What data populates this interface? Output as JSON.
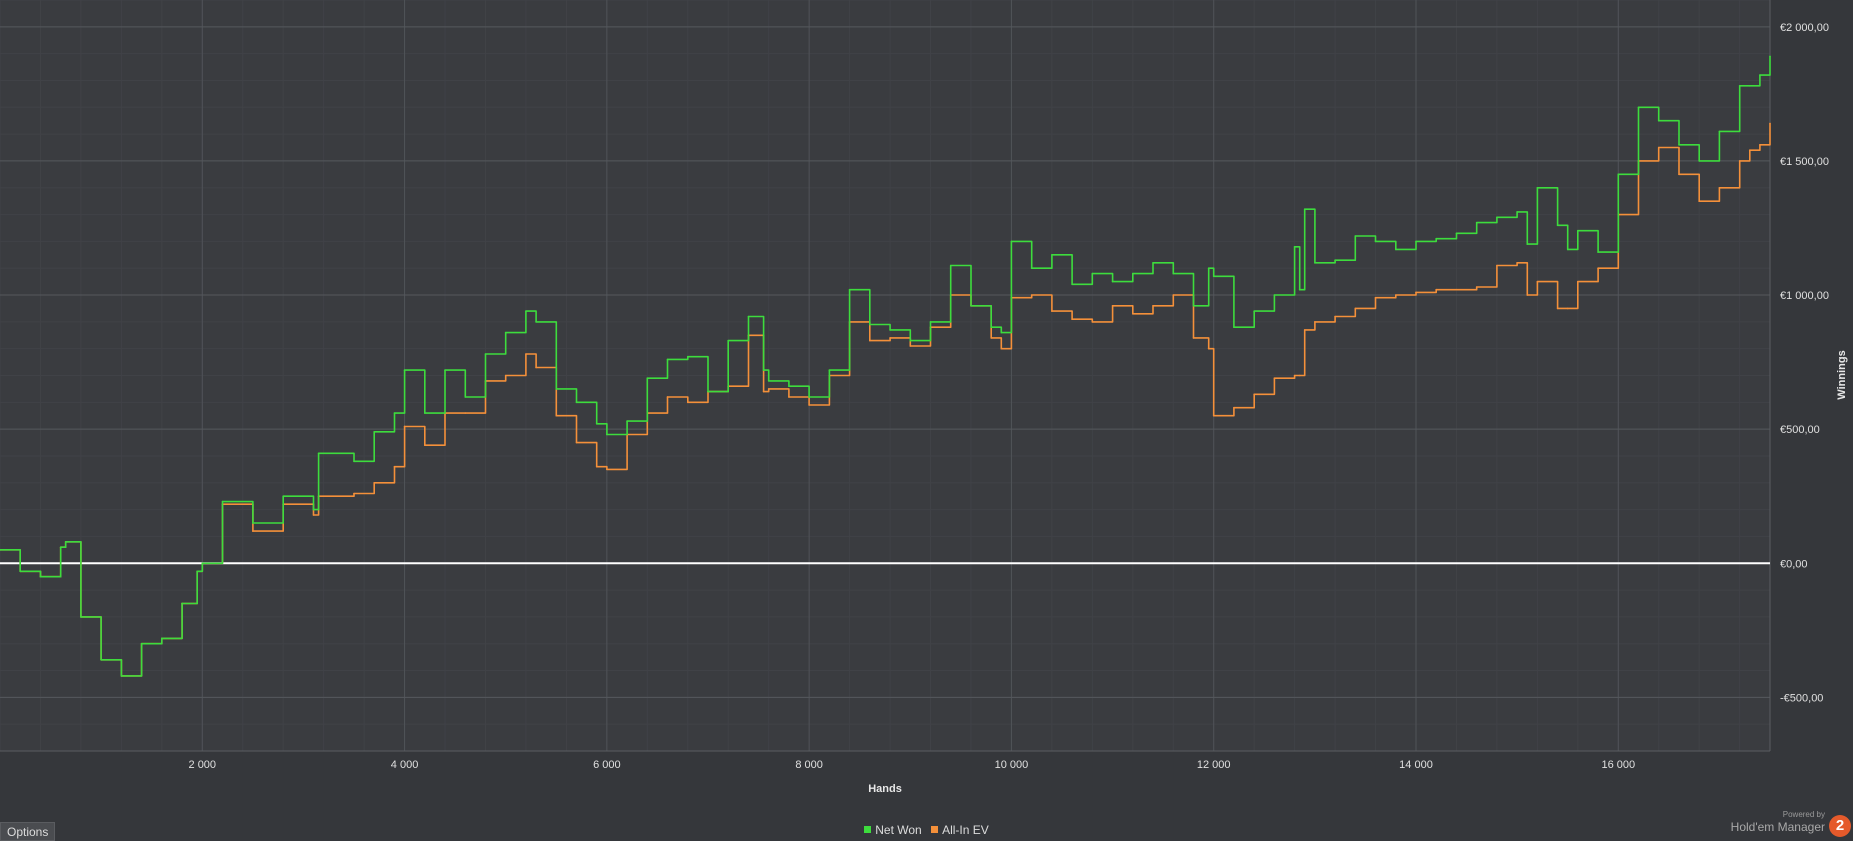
{
  "chart_data": {
    "type": "line",
    "title": "",
    "xlabel": "Hands",
    "ylabel": "Winnings",
    "xlim": [
      0,
      17500
    ],
    "ylim": [
      -700,
      2100
    ],
    "x_ticks": [
      2000,
      4000,
      6000,
      8000,
      10000,
      12000,
      14000,
      16000
    ],
    "x_tick_labels": [
      "2 000",
      "4 000",
      "6 000",
      "8 000",
      "10 000",
      "12 000",
      "14 000",
      "16 000"
    ],
    "y_ticks": [
      2000,
      1500,
      1000,
      500,
      0,
      -500
    ],
    "y_tick_labels": [
      "€2 000,00",
      "€1 500,00",
      "€1 000,00",
      "€500,00",
      "€0,00",
      "-€500,00"
    ],
    "grid": true,
    "legend_position": "bottom-center",
    "zero_line": true,
    "series": [
      {
        "name": "Net Won",
        "color": "#3ddc3d",
        "x": [
          0,
          200,
          400,
          600,
          650,
          800,
          1000,
          1200,
          1400,
          1600,
          1800,
          1950,
          2000,
          2200,
          2500,
          2800,
          3100,
          3150,
          3500,
          3700,
          3900,
          4000,
          4200,
          4400,
          4600,
          4800,
          5000,
          5200,
          5300,
          5500,
          5700,
          5900,
          6000,
          6200,
          6400,
          6600,
          6800,
          7000,
          7200,
          7400,
          7550,
          7600,
          7800,
          8000,
          8200,
          8400,
          8600,
          8800,
          9000,
          9200,
          9400,
          9600,
          9800,
          9900,
          10000,
          10200,
          10400,
          10600,
          10800,
          11000,
          11200,
          11400,
          11600,
          11800,
          11950,
          12000,
          12200,
          12400,
          12600,
          12800,
          12850,
          12900,
          13000,
          13200,
          13400,
          13600,
          13800,
          14000,
          14200,
          14400,
          14600,
          14800,
          15000,
          15100,
          15200,
          15400,
          15500,
          15600,
          15800,
          16000,
          16200,
          16400,
          16600,
          16800,
          17000,
          17200,
          17300,
          17400,
          17500
        ],
        "y": [
          50,
          -30,
          -50,
          60,
          80,
          -200,
          -360,
          -420,
          -300,
          -280,
          -150,
          -30,
          0,
          230,
          150,
          250,
          200,
          410,
          380,
          490,
          560,
          720,
          560,
          720,
          620,
          780,
          860,
          940,
          900,
          650,
          600,
          520,
          480,
          530,
          690,
          760,
          770,
          640,
          830,
          920,
          720,
          680,
          660,
          620,
          720,
          1020,
          890,
          870,
          830,
          900,
          1110,
          960,
          880,
          860,
          1200,
          1100,
          1150,
          1040,
          1080,
          1050,
          1080,
          1120,
          1080,
          960,
          1100,
          1070,
          880,
          940,
          1000,
          1180,
          1020,
          1320,
          1120,
          1130,
          1220,
          1200,
          1170,
          1200,
          1210,
          1230,
          1270,
          1290,
          1310,
          1190,
          1400,
          1260,
          1170,
          1240,
          1160,
          1450,
          1700,
          1650,
          1560,
          1500,
          1610,
          1780,
          1780,
          1820,
          1890
        ]
      },
      {
        "name": "All-In EV",
        "color": "#f4903a",
        "x": [
          0,
          200,
          400,
          600,
          650,
          800,
          1000,
          1200,
          1400,
          1600,
          1800,
          1950,
          2000,
          2200,
          2500,
          2800,
          3100,
          3150,
          3500,
          3700,
          3900,
          4000,
          4200,
          4400,
          4600,
          4800,
          5000,
          5200,
          5300,
          5500,
          5700,
          5900,
          6000,
          6200,
          6400,
          6600,
          6800,
          7000,
          7200,
          7400,
          7550,
          7600,
          7800,
          8000,
          8200,
          8400,
          8600,
          8800,
          9000,
          9200,
          9400,
          9600,
          9800,
          9900,
          10000,
          10200,
          10400,
          10600,
          10800,
          11000,
          11200,
          11400,
          11600,
          11800,
          11950,
          12000,
          12200,
          12400,
          12600,
          12800,
          12850,
          12900,
          13000,
          13200,
          13400,
          13600,
          13800,
          14000,
          14200,
          14400,
          14600,
          14800,
          15000,
          15100,
          15200,
          15400,
          15500,
          15600,
          15800,
          16000,
          16200,
          16400,
          16600,
          16800,
          17000,
          17200,
          17300,
          17400,
          17500
        ],
        "y": [
          50,
          -30,
          -50,
          60,
          80,
          -200,
          -360,
          -420,
          -300,
          -280,
          -150,
          -30,
          0,
          220,
          120,
          220,
          180,
          250,
          260,
          300,
          360,
          510,
          440,
          560,
          560,
          680,
          700,
          780,
          730,
          550,
          450,
          360,
          350,
          480,
          560,
          620,
          600,
          640,
          660,
          850,
          640,
          650,
          620,
          590,
          700,
          900,
          830,
          840,
          810,
          880,
          1000,
          960,
          840,
          800,
          990,
          1000,
          940,
          910,
          900,
          960,
          930,
          960,
          1000,
          840,
          800,
          550,
          580,
          630,
          690,
          700,
          700,
          870,
          900,
          920,
          950,
          990,
          1000,
          1010,
          1020,
          1020,
          1030,
          1110,
          1120,
          1000,
          1050,
          950,
          950,
          1050,
          1100,
          1300,
          1500,
          1550,
          1450,
          1350,
          1400,
          1500,
          1540,
          1560,
          1640
        ]
      }
    ]
  },
  "ui": {
    "options_label": "Options",
    "legend_net_won": "Net Won",
    "legend_allin_ev": "All-In EV",
    "net_won_color": "#3ddc3d",
    "allin_ev_color": "#f4903a",
    "powered_by": "Powered by",
    "brand_name": "Hold'em Manager",
    "brand_logo": "2"
  }
}
